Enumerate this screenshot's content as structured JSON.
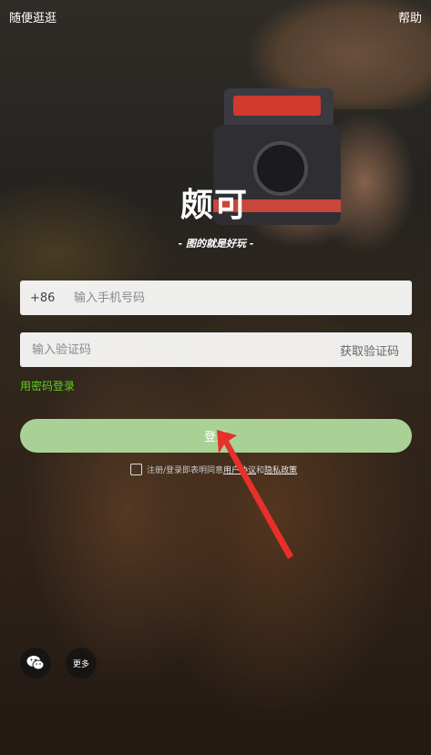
{
  "top_bar": {
    "left_label": "随便逛逛",
    "right_label": "帮助"
  },
  "brand": {
    "logo_text": "颇可",
    "slogan": "- 图的就是好玩 -"
  },
  "phone_field": {
    "country_code": "+86",
    "placeholder": "输入手机号码"
  },
  "code_field": {
    "placeholder": "输入验证码",
    "get_code_label": "获取验证码"
  },
  "password_login_label": "用密码登录",
  "login_button_label": "登录",
  "agreement": {
    "prefix": "注册/登录即表明同意",
    "user_agreement": "用户协议",
    "conjunction": "和",
    "privacy_policy": "隐私政策"
  },
  "social": {
    "more_label": "更多",
    "wechat_icon": "wechat-icon"
  },
  "colors": {
    "accent_green": "#5dd21e",
    "login_button": "#a9d196",
    "annotation_arrow": "#e8302a"
  }
}
